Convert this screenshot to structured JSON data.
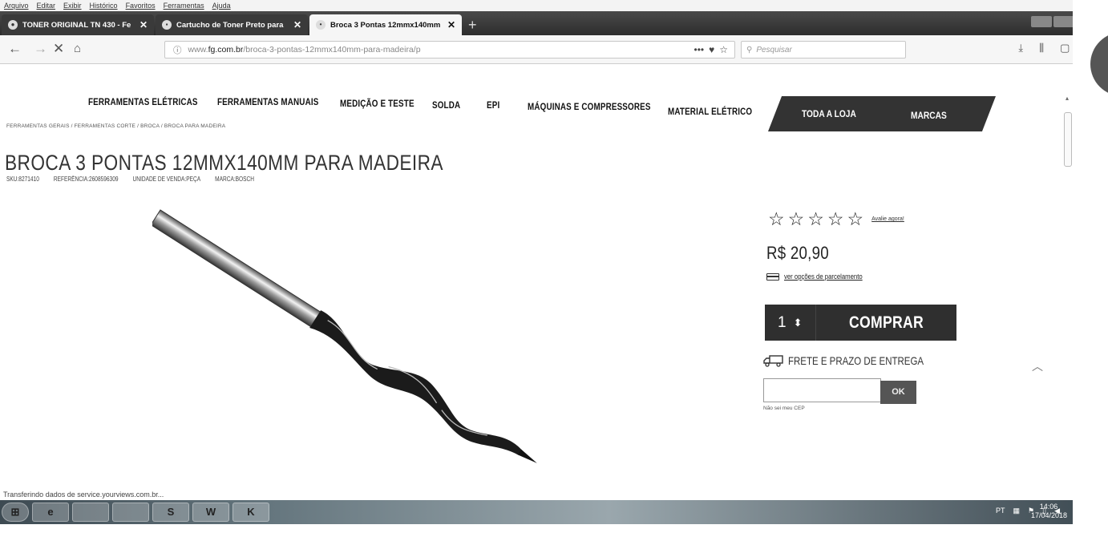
{
  "browser": {
    "menu": [
      "Arquivo",
      "Editar",
      "Exibir",
      "Histórico",
      "Favoritos",
      "Ferramentas",
      "Ajuda"
    ],
    "tabs": [
      {
        "title": "TONER ORIGINAL TN 430 - Fe",
        "active": false
      },
      {
        "title": "Cartucho de Toner Preto para",
        "active": false
      },
      {
        "title": "Broca 3 Pontas 12mmx140mm",
        "active": true
      }
    ],
    "url_prefix": "www.",
    "url_host": "fg.com.br",
    "url_path": "/broca-3-pontas-12mmx140mm-para-madeira/p",
    "search_placeholder": "Pesquisar",
    "status_text": "Transferindo dados de service.yourviews.com.br..."
  },
  "site": {
    "nav": [
      "FERRAMENTAS ELÉTRICAS",
      "FERRAMENTAS MANUAIS",
      "MEDIÇÃO E TESTE",
      "SOLDA",
      "EPI",
      "MÁQUINAS E COMPRESSORES",
      "MATERIAL ELÉTRICO"
    ],
    "nav_store": "TODA A LOJA",
    "nav_brands": "MARCAS",
    "breadcrumb": "FERRAMENTAS GERAIS / FERRAMENTAS CORTE / BROCA / BROCA PARA MADEIRA"
  },
  "product": {
    "title": "BROCA 3 PONTAS 12MMX140MM PARA MADEIRA",
    "sku": "SKU:8271410",
    "reference": "REFERÊNCIA:2608596309",
    "unit": "UNIDADE DE VENDA:PEÇA",
    "brand": "MARCA:BOSCH",
    "rating_link": "Avalie agora!",
    "rating": 0,
    "price": "R$ 20,90",
    "installments_link": "ver opções de parcelamento",
    "quantity": "1",
    "buy_label": "COMPRAR",
    "shipping_label": "FRETE E PRAZO DE ENTREGA",
    "cep_button": "OK",
    "cep_help": "Não sei meu CEP"
  },
  "taskbar": {
    "items": [
      "e",
      "",
      "",
      "S",
      "W",
      "K"
    ],
    "tray_lang": "PT",
    "time": "14:06",
    "date": "17/04/2018"
  },
  "colors": {
    "dark_panel": "#2f2f2f",
    "tab_bar": "#3a3a3a"
  }
}
